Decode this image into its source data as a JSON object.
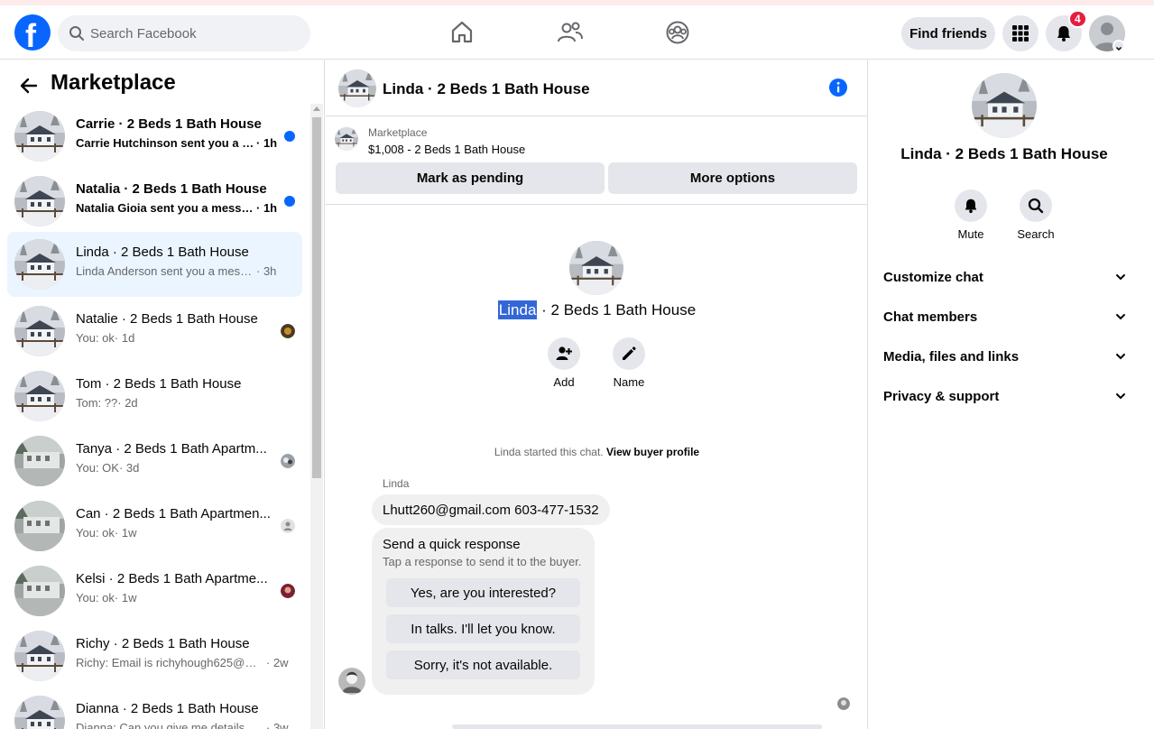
{
  "topbar": {
    "logo": "f",
    "search_placeholder": "Search Facebook",
    "find_friends_label": "Find friends",
    "notification_count": "4",
    "icons": [
      "home-icon",
      "friends-icon",
      "groups-icon",
      "menu-grid-icon",
      "bell-icon"
    ]
  },
  "sidebar": {
    "title": "Marketplace",
    "conversations": [
      {
        "name": "Carrie · 2 Beds 1 Bath House",
        "snippet": "Carrie Hutchinson sent you a m...",
        "time": "· 1h",
        "unread": true
      },
      {
        "name": "Natalia · 2 Beds 1 Bath House",
        "snippet": "Natalia Gioia sent you a messag...",
        "time": "· 1h",
        "unread": true
      },
      {
        "name": "Linda · 2 Beds 1 Bath House",
        "snippet": "Linda Anderson sent you a messag...",
        "time": "· 3h",
        "active": true
      },
      {
        "name": "Natalie · 2 Beds 1 Bath House",
        "snippet": "You: ok",
        "time": "· 1d"
      },
      {
        "name": "Tom · 2 Beds 1 Bath House",
        "snippet": "Tom: ??",
        "time": "· 2d"
      },
      {
        "name": "Tanya · 2 Beds 1 Bath Apartm...",
        "snippet": "You: OK",
        "time": "· 3d"
      },
      {
        "name": "Can · 2 Beds 1 Bath Apartmen...",
        "snippet": "You: ok",
        "time": "· 1w"
      },
      {
        "name": "Kelsi · 2 Beds 1 Bath Apartme...",
        "snippet": "You: ok",
        "time": "· 1w"
      },
      {
        "name": "Richy · 2 Beds 1 Bath House",
        "snippet": "Richy: Email is richyhough625@g...",
        "time": "· 2w"
      },
      {
        "name": "Dianna · 2 Beds 1 Bath House",
        "snippet": "Dianna: Can you give me details a...",
        "time": "· 3w"
      }
    ]
  },
  "chat": {
    "header_title": "Linda · 2 Beds 1 Bath House",
    "listing_tag": "Marketplace",
    "listing_price": "$1,008 - 2 Beds 1 Bath House",
    "mark_pending_label": "Mark as pending",
    "more_options_label": "More options",
    "title_name": "Linda",
    "title_rest": " · 2 Beds 1 Bath House",
    "add_label": "Add",
    "name_label": "Name",
    "started_text": "Linda started this chat. ",
    "view_profile_label": "View buyer profile",
    "sender": "Linda",
    "message": "Lhutt260@gmail.com 603-477-1532",
    "quick_title": "Send a quick response",
    "quick_sub": "Tap a response to send it to the buyer.",
    "quick_options": [
      "Yes, are you interested?",
      "In talks. I'll let you know.",
      "Sorry, it's not available."
    ]
  },
  "details": {
    "title": "Linda · 2 Beds 1 Bath House",
    "mute_label": "Mute",
    "search_label": "Search",
    "sections": [
      "Customize chat",
      "Chat members",
      "Media, files and links",
      "Privacy & support"
    ]
  },
  "colors": {
    "brand": "#0866ff",
    "badge": "#e41e3f",
    "active_row": "#ebf5ff",
    "highlight": "#3367d6"
  }
}
